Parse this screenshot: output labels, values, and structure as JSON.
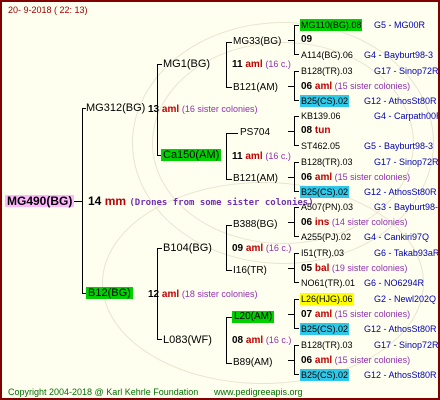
{
  "header": {
    "date": "20-  9-2018 ( 22: 13)"
  },
  "footer": {
    "copyright": "Copyright 2004-2018 @ Karl Kehrle Foundation",
    "url": "www.pedigreeapis.org"
  },
  "root": {
    "name": "MG490(BG)",
    "gen_num": "14",
    "gen_unit": "mm",
    "note": "(Drones from some sister colonies)"
  },
  "dam_side": {
    "name": "MG312(BG)",
    "num": "13",
    "unit": "aml",
    "note": "(16 sister colonies)",
    "mg1": {
      "name": "MG1(BG)",
      "num": "11",
      "unit": "aml",
      "note": "(16 c.)",
      "mg33": {
        "name": "MG33(BG)"
      },
      "b121": {
        "name": "B121(AM)"
      }
    },
    "ca150": {
      "name": "Ca150(AM)",
      "num": "11",
      "unit": "aml",
      "note": "(16 c.)",
      "ps704": {
        "name": "PS704"
      },
      "b121": {
        "name": "B121(AM)"
      }
    }
  },
  "sire_side": {
    "name": "B12(BG)",
    "num": "12",
    "unit": "aml",
    "note": "(18 sister colonies)",
    "b104": {
      "name": "B104(BG)",
      "num": "09",
      "unit": "aml",
      "note": "(16 c.)",
      "b388": {
        "name": "B388(BG)"
      },
      "i16": {
        "name": "I16(TR)"
      }
    },
    "l083": {
      "name": "L083(WF)",
      "num": "08",
      "unit": "aml",
      "note": "(16 c.)",
      "l20": {
        "name": "L20(AM)"
      },
      "b89": {
        "name": "B89(AM)"
      }
    }
  },
  "gen5": [
    {
      "top": "MG110(BG).08",
      "topcode": "G5 - MG00R",
      "num": "09",
      "unit": "",
      "note": "",
      "bottom": "A114(BG).06",
      "botcode": "G4 - Bayburt98-3"
    },
    {
      "top": "B128(TR).03",
      "topcode": "G17 - Sinop72R",
      "num": "06",
      "unit": "aml",
      "note": "(15 sister colonies)",
      "bottom": "B25(CS).02",
      "botcode": "G12 - AthosSt80R"
    },
    {
      "top": "KB139.06",
      "topcode": "G4 - Carpath00R",
      "num": "08",
      "unit": "tun",
      "note": "",
      "bottom": "ST462.05",
      "botcode": "G5 - Bayburt98-3"
    },
    {
      "top": "B128(TR).03",
      "topcode": "G17 - Sinop72R",
      "num": "06",
      "unit": "aml",
      "note": "(15 sister colonies)",
      "bottom": "B25(CS).02",
      "botcode": "G12 - AthosSt80R"
    },
    {
      "top": "A507(PN).03",
      "topcode": "G3 - Bayburt98-3",
      "num": "06",
      "unit": "ins",
      "note": "(14 sister colonies)",
      "bottom": "A255(PJ).02",
      "botcode": "G4 - Cankiri97Q"
    },
    {
      "top": "I51(TR).03",
      "topcode": "G6 - Takab93aR",
      "num": "05",
      "unit": "bal",
      "note": "(19 sister colonies)",
      "bottom": "NO61(TR).01",
      "botcode": "G6 - NO6294R"
    },
    {
      "top": "L26(HJG).06",
      "topcode": "G2 - Newl202Q",
      "num": "07",
      "unit": "aml",
      "note": "(15 sister colonies)",
      "bottom": "B25(CS).02",
      "botcode": "G12 - AthosSt80R"
    },
    {
      "top": "B128(TR).03",
      "topcode": "G17 - Sinop72R",
      "num": "06",
      "unit": "aml",
      "note": "(15 sister colonies)",
      "bottom": "B25(CS).02",
      "botcode": "G12 - AthosSt80R"
    }
  ]
}
